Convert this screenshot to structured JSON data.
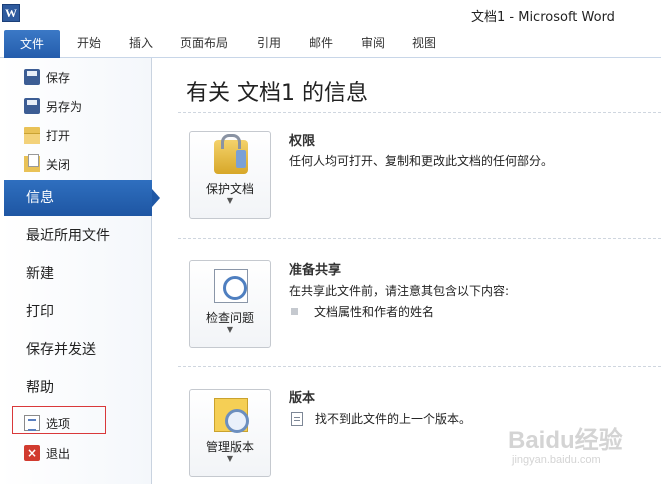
{
  "window": {
    "app_icon": "word-icon",
    "app_icon_letter": "W",
    "title": "文档1  -  Microsoft Word"
  },
  "ribbon": {
    "file_tab": "文件",
    "tabs": [
      "开始",
      "插入",
      "页面布局",
      "引用",
      "邮件",
      "审阅",
      "视图"
    ]
  },
  "backstage_nav": {
    "commands": [
      {
        "label": "保存",
        "icon": "save-icon"
      },
      {
        "label": "另存为",
        "icon": "save-as-icon"
      },
      {
        "label": "打开",
        "icon": "open-folder-icon"
      },
      {
        "label": "关闭",
        "icon": "close-document-icon"
      }
    ],
    "sections": [
      {
        "label": "信息",
        "selected": true
      },
      {
        "label": "最近所用文件"
      },
      {
        "label": "新建"
      },
      {
        "label": "打印"
      },
      {
        "label": "保存并发送"
      },
      {
        "label": "帮助"
      }
    ],
    "footer": [
      {
        "label": "选项",
        "icon": "options-icon",
        "highlighted": true
      },
      {
        "label": "退出",
        "icon": "exit-icon"
      }
    ],
    "highlight_color": "#d9383a",
    "selected_color": "#2a65b5"
  },
  "info_page": {
    "title": "有关 文档1 的信息",
    "sections": [
      {
        "button_label": "保护文档",
        "button_icon": "lock-keys-icon",
        "heading": "权限",
        "description": "任何人均可打开、复制和更改此文档的任何部分。"
      },
      {
        "button_label": "检查问题",
        "button_icon": "inspect-document-icon",
        "heading": "准备共享",
        "description": "在共享此文件前，请注意其包含以下内容:",
        "bullets": [
          "文档属性和作者的姓名"
        ]
      },
      {
        "button_label": "管理版本",
        "button_icon": "manage-versions-icon",
        "heading": "版本",
        "bullets": [
          "找不到此文件的上一个版本。"
        ]
      }
    ]
  },
  "watermark": {
    "logo": "Baidu经验",
    "url": "jingyan.baidu.com"
  }
}
